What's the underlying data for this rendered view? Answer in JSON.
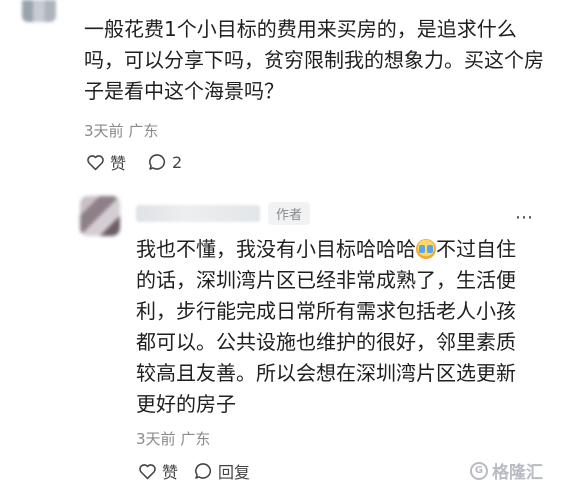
{
  "comment_main": {
    "text": "一般花费1个小目标的费用来买房的，是追求什么吗，可以分享下吗，贫穷限制我的想象力。买这个房子是看中这个海景吗？",
    "time": "3天前",
    "location": "广东",
    "like_label": "赞",
    "reply_count": "2"
  },
  "reply": {
    "author_badge": "作者",
    "more_icon": "more-icon",
    "text_before_emoji": "我也不懂，我没有小目标哈哈哈",
    "text_after_emoji": "不过自住的话，深圳湾片区已经非常成熟了，生活便利，步行能完成日常所有需求包括老人小孩都可以。公共设施也维护的很好，邻里素质较高且友善。所以会想在深圳湾片区选更新更好的房子",
    "time": "3天前",
    "location": "广东",
    "like_label": "赞",
    "reply_label": "回复"
  },
  "watermark": {
    "text": "格隆汇"
  }
}
